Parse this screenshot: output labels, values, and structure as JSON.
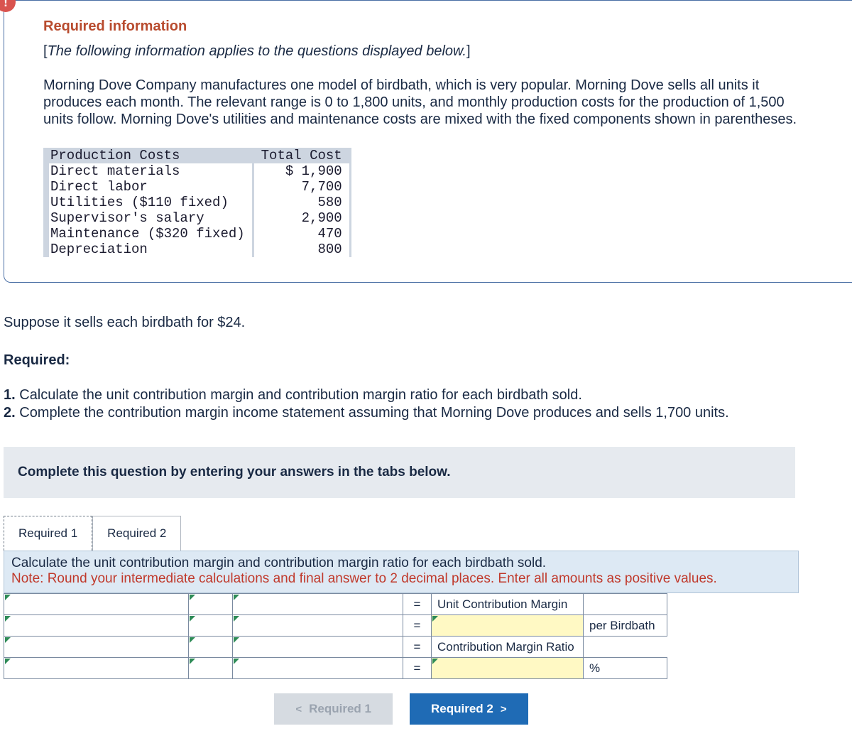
{
  "info": {
    "warn_glyph": "!",
    "title": "Required information",
    "subtitle_open": "[",
    "subtitle_italic": "The following information applies to the questions displayed below.",
    "subtitle_close": "]",
    "paragraph": "Morning Dove Company manufactures one model of birdbath, which is very popular. Morning Dove sells all units it produces each month. The relevant range is 0 to 1,800 units, and monthly production costs for the production of 1,500 units follow. Morning Dove's utilities and maintenance costs are mixed with the fixed components shown in parentheses."
  },
  "cost_table": {
    "headers": {
      "c1": "Production Costs",
      "c2": "Total Cost"
    },
    "rows": [
      {
        "label": "Direct materials",
        "value": "$ 1,900"
      },
      {
        "label": "Direct labor",
        "value": "7,700"
      },
      {
        "label": "Utilities ($110 fixed)",
        "value": "580"
      },
      {
        "label": "Supervisor's salary",
        "value": "2,900"
      },
      {
        "label": "Maintenance ($320 fixed)",
        "value": "470"
      },
      {
        "label": "Depreciation",
        "value": "800"
      }
    ]
  },
  "question": {
    "suppose": "Suppose it sells each birdbath for $24.",
    "required_hdr": "Required:",
    "items": [
      {
        "num": "1.",
        "text": " Calculate the unit contribution margin and contribution margin ratio for each birdbath sold."
      },
      {
        "num": "2.",
        "text": " Complete the contribution margin income statement assuming that Morning Dove produces and sells 1,700 units."
      }
    ],
    "instruction": "Complete this question by entering your answers in the tabs below."
  },
  "tabs": {
    "t1": "Required 1",
    "t2": "Required 2"
  },
  "panel": {
    "prompt": "Calculate the unit contribution margin and contribution margin ratio for each birdbath sold.",
    "note": "Note: Round your intermediate calculations and final answer to 2 decimal places. Enter all amounts as positive values."
  },
  "grid": {
    "eq": "=",
    "row1_label": "Unit Contribution Margin",
    "row2_suffix": "per Birdbath",
    "row3_label": "Contribution Margin Ratio",
    "row4_suffix": "%"
  },
  "nav": {
    "prev_chev": "<",
    "prev": "Required 1",
    "next": "Required 2",
    "next_chev": ">"
  }
}
